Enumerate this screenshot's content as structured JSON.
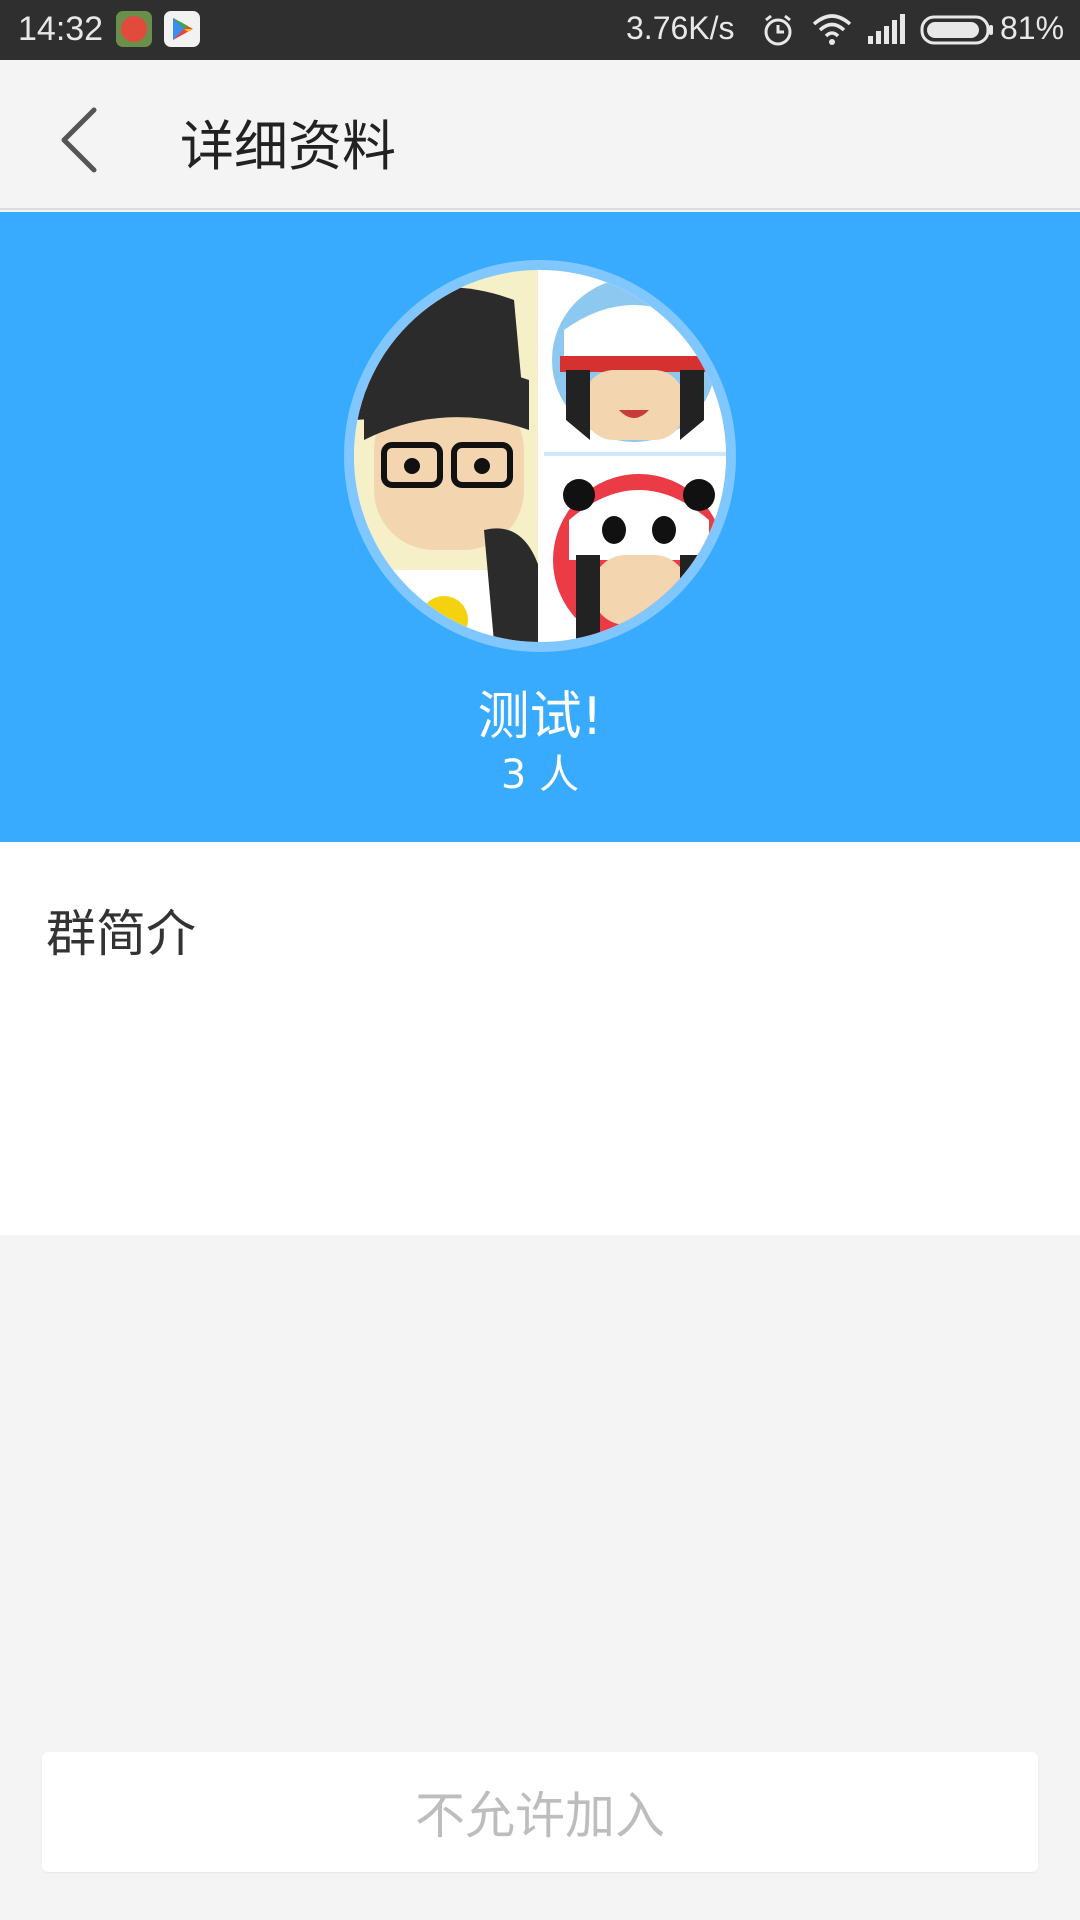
{
  "status_bar": {
    "time": "14:32",
    "network_speed": "3.76K/s",
    "battery_percent": "81%",
    "icons": [
      "app-notification-icon",
      "play-store-icon",
      "alarm-icon",
      "wifi-icon",
      "signal-icon",
      "battery-icon"
    ]
  },
  "header": {
    "back_icon": "chevron-left-icon",
    "title": "详细资料"
  },
  "profile": {
    "group_name": "测试!",
    "member_count": "3 人",
    "avatar": "group-avatar-collage",
    "background_color": "#38abff"
  },
  "intro": {
    "label": "群简介",
    "content": ""
  },
  "footer": {
    "join_button_label": "不允许加入",
    "join_button_enabled": false
  }
}
